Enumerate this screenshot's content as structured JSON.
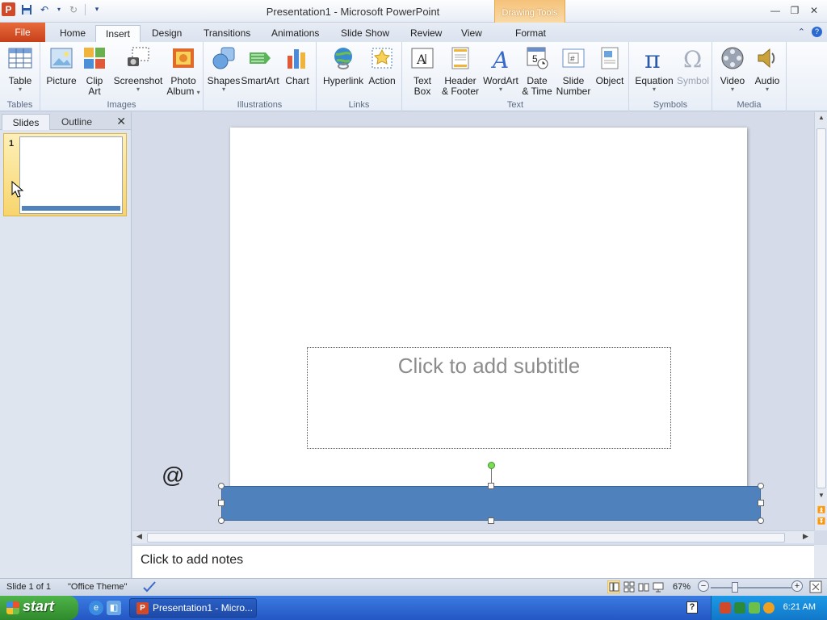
{
  "window": {
    "title": "Presentation1  -  Microsoft PowerPoint",
    "context_tab_header": "Drawing Tools",
    "app_icon_letter": "P"
  },
  "tabs": [
    {
      "label": "File"
    },
    {
      "label": "Home"
    },
    {
      "label": "Insert",
      "active": true
    },
    {
      "label": "Design"
    },
    {
      "label": "Transitions"
    },
    {
      "label": "Animations"
    },
    {
      "label": "Slide Show"
    },
    {
      "label": "Review"
    },
    {
      "label": "View"
    },
    {
      "label": "Format"
    }
  ],
  "ribbon": {
    "groups": {
      "tables": "Tables",
      "images": "Images",
      "illustrations": "Illustrations",
      "links": "Links",
      "text": "Text",
      "symbols": "Symbols",
      "media": "Media"
    },
    "buttons": {
      "table": "Table",
      "picture": "Picture",
      "clip_art_1": "Clip",
      "clip_art_2": "Art",
      "screenshot": "Screenshot",
      "photo_album_1": "Photo",
      "photo_album_2": "Album",
      "shapes": "Shapes",
      "smartart": "SmartArt",
      "chart": "Chart",
      "hyperlink": "Hyperlink",
      "action": "Action",
      "text_box_1": "Text",
      "text_box_2": "Box",
      "header_footer_1": "Header",
      "header_footer_2": "& Footer",
      "wordart": "WordArt",
      "date_time_1": "Date",
      "date_time_2": "& Time",
      "slide_number_1": "Slide",
      "slide_number_2": "Number",
      "object": "Object",
      "equation": "Equation",
      "symbol": "Symbol",
      "video": "Video",
      "audio": "Audio"
    }
  },
  "slides_pane": {
    "tab_slides": "Slides",
    "tab_outline": "Outline",
    "close_glyph": "✕",
    "thumbnail_number": "1"
  },
  "slide": {
    "subtitle_placeholder": "Click to add subtitle",
    "stray_glyph": "@",
    "shape_fill": "#4f81bd"
  },
  "notes": {
    "placeholder": "Click to add notes"
  },
  "status_bar": {
    "slide_info": "Slide 1 of 1",
    "theme": "\"Office Theme\"",
    "zoom": "67%",
    "zoom_minus": "−",
    "zoom_plus": "+",
    "zoom_level_fraction": 0.67
  },
  "taskbar": {
    "start_label": "start",
    "task_label": "Presentation1 - Micro...",
    "task_icon_letter": "P",
    "help_glyph": "?",
    "clock": "6:21 AM"
  },
  "colors": {
    "accent": "#4f81bd",
    "file_tab": "#c7401a",
    "context_tab": "#f5c27a"
  }
}
